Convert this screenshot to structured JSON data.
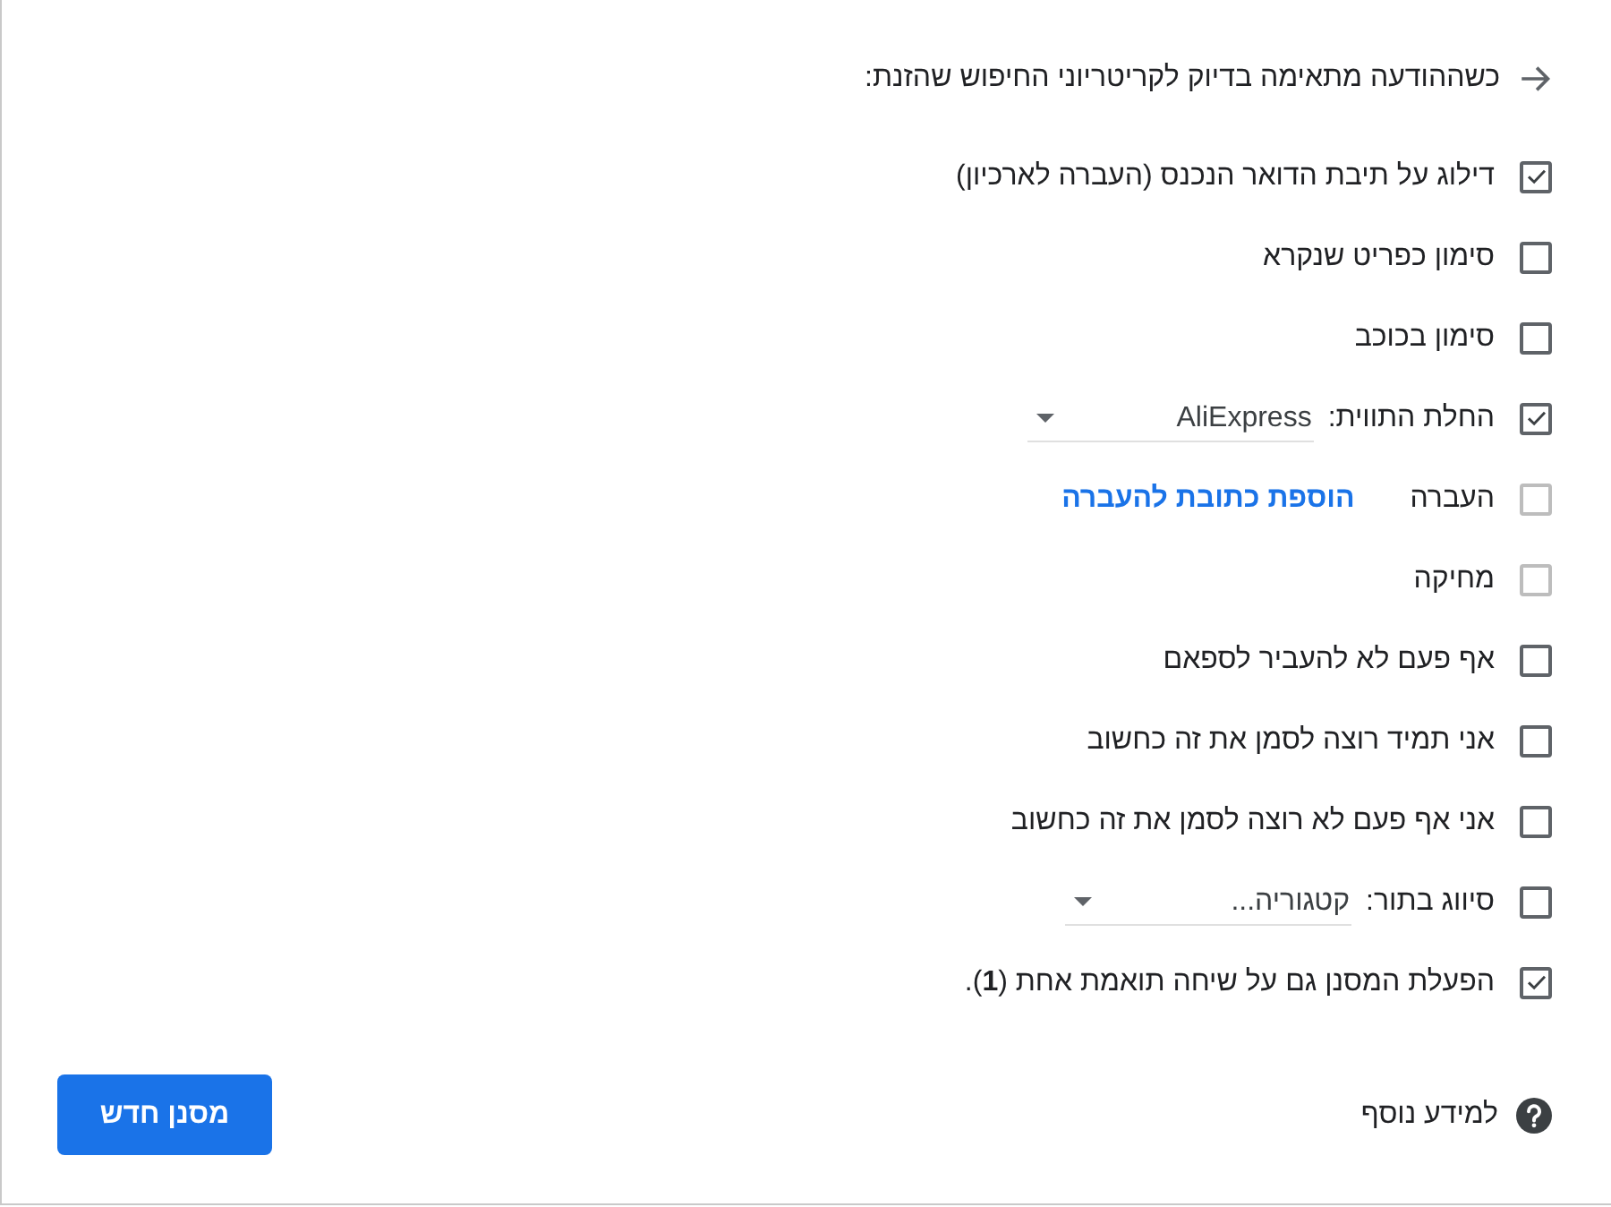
{
  "header": {
    "text": "כשההודעה מתאימה בדיוק לקריטריוני החיפוש שהזנת:"
  },
  "options": [
    {
      "kind": "plain",
      "label": "דילוג על תיבת הדואר הנכנס (העברה לארכיון)",
      "checked": true,
      "disabled": false
    },
    {
      "kind": "plain",
      "label": "סימון כפריט שנקרא",
      "checked": false,
      "disabled": false
    },
    {
      "kind": "plain",
      "label": "סימון בכוכב",
      "checked": false,
      "disabled": false
    },
    {
      "kind": "select",
      "label": "החלת התווית:",
      "value": "AliExpress",
      "checked": true,
      "disabled": false
    },
    {
      "kind": "link",
      "label": "העברה",
      "link": "הוספת כתובת להעברה",
      "checked": false,
      "disabled": true
    },
    {
      "kind": "plain",
      "label": "מחיקה",
      "checked": false,
      "disabled": true
    },
    {
      "kind": "plain",
      "label": "אף פעם לא להעביר לספאם",
      "checked": false,
      "disabled": false
    },
    {
      "kind": "plain",
      "label": "אני תמיד רוצה לסמן את זה כחשוב",
      "checked": false,
      "disabled": false
    },
    {
      "kind": "plain",
      "label": "אני אף פעם לא רוצה לסמן את זה כחשוב",
      "checked": false,
      "disabled": false
    },
    {
      "kind": "select",
      "label": "סיווג בתור:",
      "value": "קטגוריה...",
      "checked": false,
      "disabled": false
    },
    {
      "kind": "plain",
      "label": "הפעלת המסנן גם על שיחה תואמת אחת (**1**).",
      "checked": true,
      "disabled": false
    }
  ],
  "footer": {
    "help_link": "למידע נוסף",
    "create_button": "מסנן חדש"
  }
}
